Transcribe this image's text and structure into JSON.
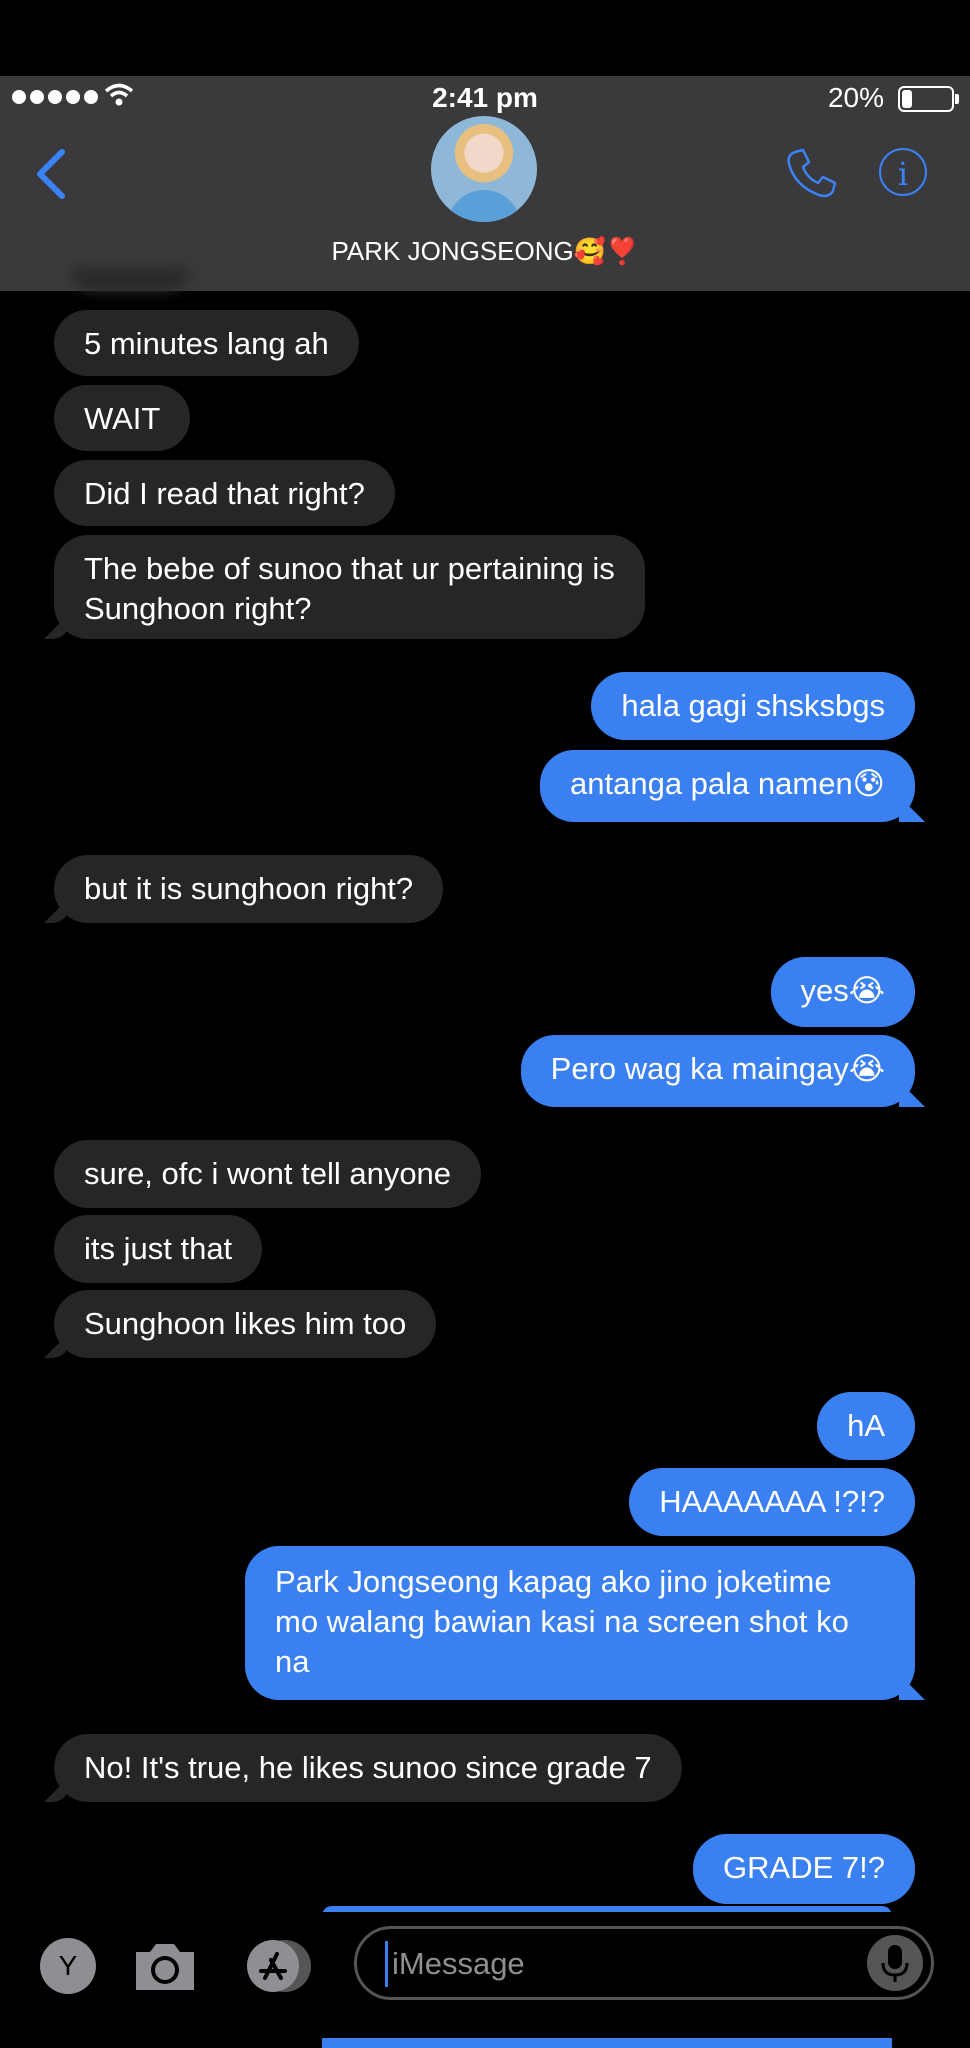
{
  "status": {
    "time": "2:41 pm",
    "battery": "20%",
    "battery_level": 0.2
  },
  "header": {
    "contact_name": "PARK JONGSEONG🥰❣️"
  },
  "messages": [
    {
      "from": "them",
      "text": "5 minutes lang ah"
    },
    {
      "from": "them",
      "text": "WAIT"
    },
    {
      "from": "them",
      "text": "Did I read that right?"
    },
    {
      "from": "them",
      "text": "The bebe of sunoo that ur pertaining is\nSunghoon right?"
    },
    {
      "from": "me",
      "text": "hala gagi shsksbgs"
    },
    {
      "from": "me",
      "text": "antanga pala namen😰"
    },
    {
      "from": "them",
      "text": "but it is sunghoon right?"
    },
    {
      "from": "me",
      "text": "yes😭"
    },
    {
      "from": "me",
      "text": "Pero wag ka maingay😭"
    },
    {
      "from": "them",
      "text": "sure, ofc i wont tell anyone"
    },
    {
      "from": "them",
      "text": "its just that"
    },
    {
      "from": "them",
      "text": "Sunghoon likes him too"
    },
    {
      "from": "me",
      "text": "hA"
    },
    {
      "from": "me",
      "text": "HAAAAAAA !?!?"
    },
    {
      "from": "me",
      "text": "Park Jongseong kapag ako jino joketime\nmo walang bawian kasi na screen shot ko\nna"
    },
    {
      "from": "them",
      "text": "No! It's true, he likes sunoo since grade 7"
    },
    {
      "from": "me",
      "text": "GRADE 7!?"
    }
  ],
  "composer": {
    "app_label": "Y",
    "placeholder": "iMessage"
  },
  "colors": {
    "sent": "#3a80f0",
    "received": "#262628",
    "accent": "#3a82f6"
  }
}
